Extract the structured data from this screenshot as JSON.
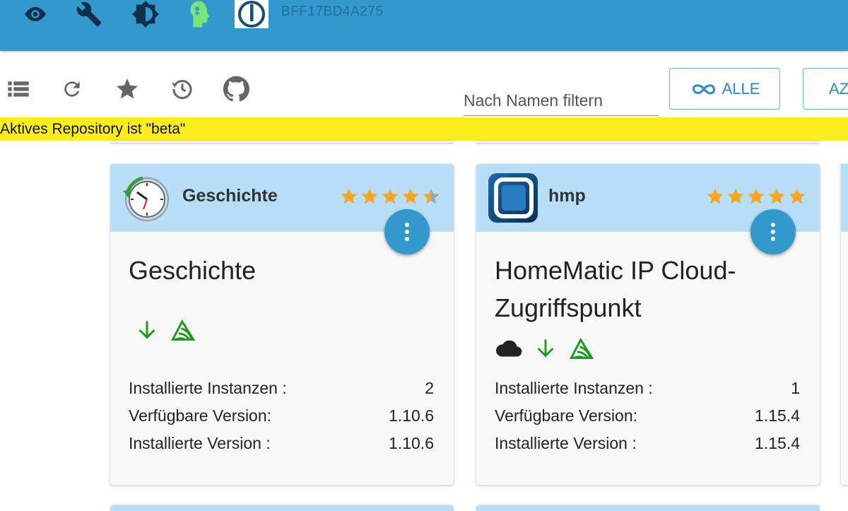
{
  "appbar": {
    "icons": [
      "eye-icon",
      "wrench-icon",
      "brightness-icon",
      "expert-head-icon",
      "iobroker-logo"
    ],
    "host_id": "BFF17BD4A275"
  },
  "toolbar": {
    "icons": [
      "list-view-icon",
      "refresh-icon",
      "star-icon",
      "history-icon",
      "github-icon"
    ],
    "filter_placeholder": "Nach Namen filtern",
    "all_button_label": "ALLE",
    "az_button_label": "AZ"
  },
  "banner": {
    "text": "Aktives Repository ist \"beta\""
  },
  "colors": {
    "appbar": "#3399cc",
    "card_header": "#b8def8",
    "banner": "#fced1f",
    "star": "#f5a623",
    "badge_green": "#1a9a1a"
  },
  "cards": [
    {
      "short_name": "Geschichte",
      "title": "Geschichte",
      "rating": 4.5,
      "badges": [
        "download-arrow-icon",
        "sentry-icon"
      ],
      "rows": [
        {
          "label": "Installierte Instanzen :",
          "value": "2"
        },
        {
          "label": "Verfügbare Version:",
          "value": "1.10.6"
        },
        {
          "label": "Installierte Version :",
          "value": "1.10.6"
        }
      ]
    },
    {
      "short_name": "hmp",
      "title": "HomeMatic IP Cloud-Zugriffspunkt",
      "rating": 5,
      "badges": [
        "cloud-icon",
        "download-arrow-icon",
        "sentry-icon"
      ],
      "rows": [
        {
          "label": "Installierte Instanzen :",
          "value": "1"
        },
        {
          "label": "Verfügbare Version:",
          "value": "1.15.4"
        },
        {
          "label": "Installierte Version :",
          "value": "1.15.4"
        }
      ]
    }
  ]
}
